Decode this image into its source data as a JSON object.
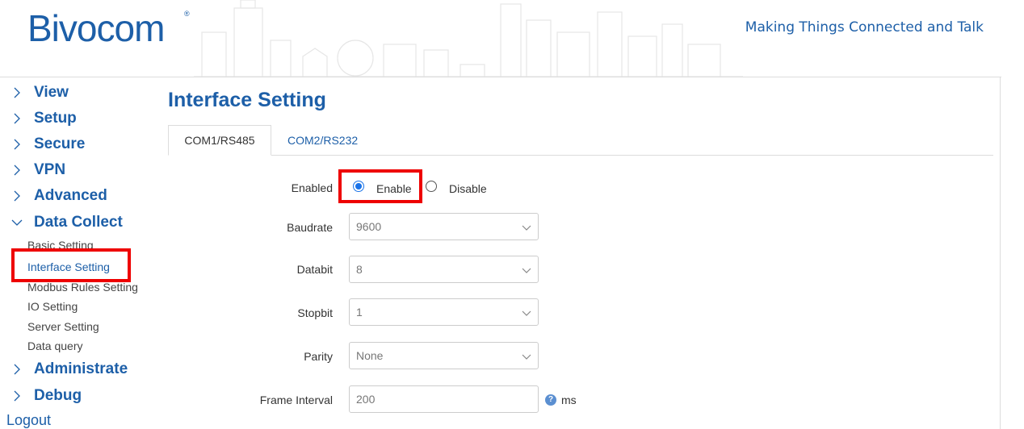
{
  "header": {
    "logo": "Bivocom",
    "logo_mark": "®",
    "tagline": "Making Things Connected and Talk"
  },
  "sidebar": {
    "items": [
      {
        "label": "View"
      },
      {
        "label": "Setup"
      },
      {
        "label": "Secure"
      },
      {
        "label": "VPN"
      },
      {
        "label": "Advanced"
      },
      {
        "label": "Data Collect",
        "expanded": true
      },
      {
        "label": "Administrate"
      },
      {
        "label": "Debug"
      }
    ],
    "subitems": [
      {
        "label": "Basic Setting"
      },
      {
        "label": "Interface Setting",
        "active": true
      },
      {
        "label": "Modbus Rules Setting"
      },
      {
        "label": "IO Setting"
      },
      {
        "label": "Server Setting"
      },
      {
        "label": "Data query"
      }
    ],
    "logout": "Logout"
  },
  "main": {
    "title": "Interface Setting",
    "tabs": [
      {
        "label": "COM1/RS485",
        "active": true
      },
      {
        "label": "COM2/RS232",
        "active": false
      }
    ],
    "form": {
      "enabled_label": "Enabled",
      "enable_option": "Enable",
      "disable_option": "Disable",
      "enabled_value": "Enable",
      "baudrate_label": "Baudrate",
      "baudrate_value": "9600",
      "databit_label": "Databit",
      "databit_value": "8",
      "stopbit_label": "Stopbit",
      "stopbit_value": "1",
      "parity_label": "Parity",
      "parity_value": "None",
      "frame_interval_label": "Frame Interval",
      "frame_interval_value": "200",
      "frame_interval_unit": "ms",
      "help_icon": "?"
    }
  },
  "colors": {
    "brand": "#1d5fa8",
    "highlight": "#ee0000",
    "radio": "#1a73e8"
  }
}
